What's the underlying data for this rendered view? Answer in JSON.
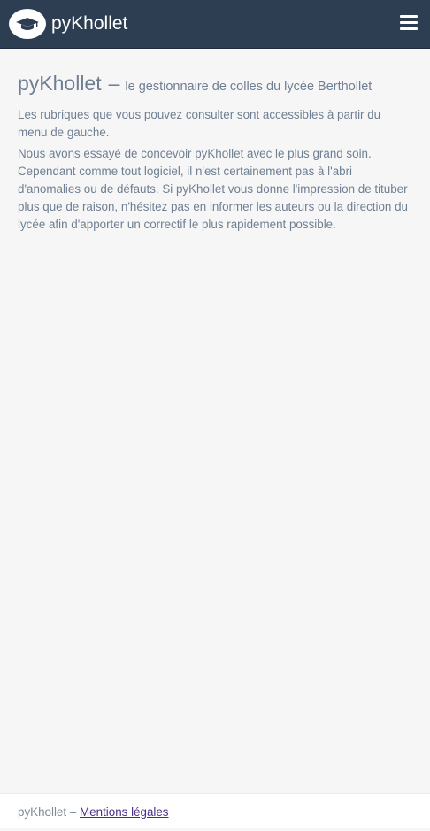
{
  "navbar": {
    "brand": "pyKhollet",
    "logo_icon": "graduation-cap-icon",
    "menu_icon": "hamburger-menu-icon"
  },
  "main": {
    "title": "pyKhollet",
    "separator": "–",
    "subtitle": "le gestionnaire de colles du lycée Berthollet",
    "paragraphs": [
      "Les rubriques que vous pouvez consulter sont accessibles à partir du menu de gauche.",
      "Nous avons essayé de concevoir pyKhollet avec le plus grand soin. Cependant comme tout logiciel, il n'est certainement pas à l'abri d'anomalies ou de défauts. Si pyKhollet vous donne l'impression de tituber plus que de raison, n'hésitez pas en informer les auteurs ou la direction du lycée afin d'apporter un correctif le plus rapidement possible."
    ]
  },
  "footer": {
    "app_name": "pyKhollet",
    "separator": "–",
    "legal_link": "Mentions légales"
  },
  "colors": {
    "navbar_bg": "#2d3d52",
    "page_bg": "#f6f6f7",
    "text": "#6f7f92",
    "link": "#4a2d86"
  }
}
